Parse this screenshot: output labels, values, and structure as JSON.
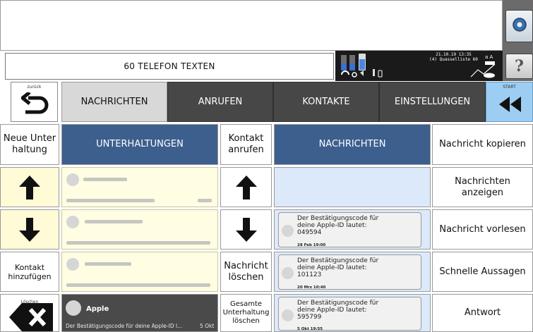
{
  "header": {
    "title": "60 TELEFON TEXTEN",
    "status_date": "21.10.19 13:35",
    "status_list": "(4) Quasselliste 60"
  },
  "nav": {
    "back_label": "zurück",
    "start_label": "START",
    "tabs": [
      {
        "label": "NACHRICHTEN"
      },
      {
        "label": "ANRUFEN"
      },
      {
        "label": "KONTAKTE"
      },
      {
        "label": "EINSTELLUNGEN"
      }
    ]
  },
  "left_col": {
    "new_conversation": "Neue Unter haltung",
    "add_contact": "Kontakt hinzufügen",
    "delete_label": "Löschen"
  },
  "conversations": {
    "header": "UNTERHALTUNGEN",
    "items": [
      {
        "name": "",
        "preview": "",
        "date": ""
      },
      {
        "name": "",
        "preview": "",
        "date": ""
      },
      {
        "name": "",
        "preview": "",
        "date": ""
      },
      {
        "name": "Apple",
        "preview": "Der Bestätigungscode für deine Apple-ID l...",
        "date": "5 Okt"
      }
    ]
  },
  "mid_col": {
    "call_contact": "Kontakt anrufen",
    "delete_message": "Nachricht löschen",
    "delete_conversation": "Gesamte Unterhaltung löschen"
  },
  "messages": {
    "header": "NACHRICHTEN",
    "items": [
      {
        "text_line1": "Der Bestätigungscode für",
        "text_line2": "deine Apple-ID lautet:",
        "code": "049594",
        "date": "28 Feb  19:00"
      },
      {
        "text_line1": "Der Bestätigungscode für",
        "text_line2": "deine Apple-ID lautet:",
        "code": "101123",
        "date": "20 Mrz  10:40"
      },
      {
        "text_line1": "Der Bestätigungscode für",
        "text_line2": "deine Apple-ID lautet:",
        "code": "595799",
        "date": "5 Okt  19:55"
      }
    ]
  },
  "actions": {
    "copy": "Nachricht kopieren",
    "show": "Nachrichten anzeigen",
    "read": "Nachricht vorlesen",
    "quick": "Schnelle Aussagen",
    "reply": "Antwort"
  },
  "colors": {
    "tab_dark": "#474747",
    "header_blue": "#3d5f8e",
    "start_blue": "#9dcdf2",
    "yellow_cell": "#fffbd6",
    "light_blue_cell": "#dce9fb"
  }
}
